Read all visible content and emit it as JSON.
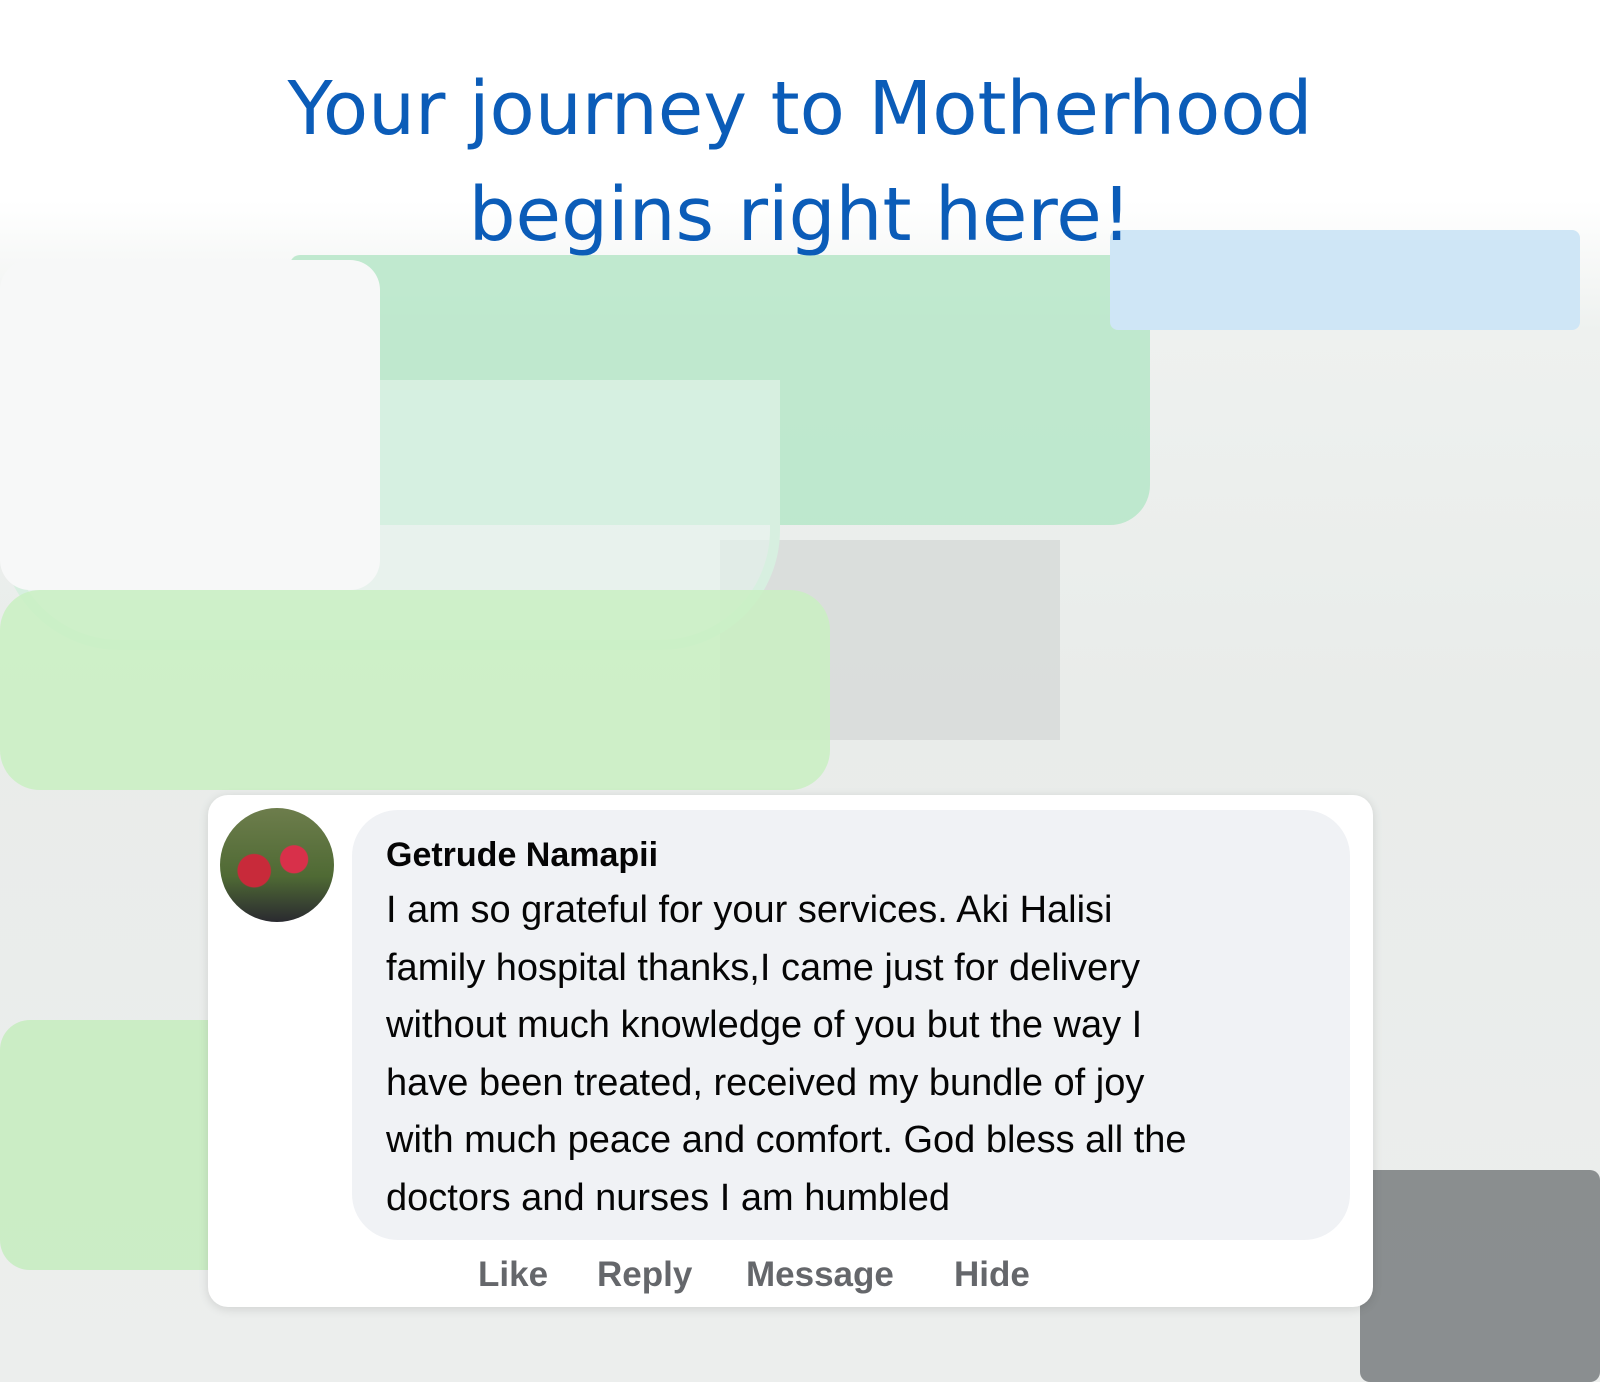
{
  "headline": {
    "line1": "Your journey to Motherhood",
    "line2": "begins right here!"
  },
  "comment": {
    "author": "Getrude Namapii",
    "lines": [
      "I am so grateful for your services. Aki Halisi",
      "family hospital thanks,I came just for delivery",
      "without much knowledge of you but the way I",
      "have been treated, received my bundle of joy",
      "with much peace and comfort. God bless all the",
      "doctors and nurses I am humbled"
    ],
    "actions": [
      "Like",
      "Reply",
      "Message",
      "Hide"
    ]
  },
  "colors": {
    "headline": "#0b5cb8",
    "bubble": "#f0f2f5",
    "action": "#65676b"
  }
}
